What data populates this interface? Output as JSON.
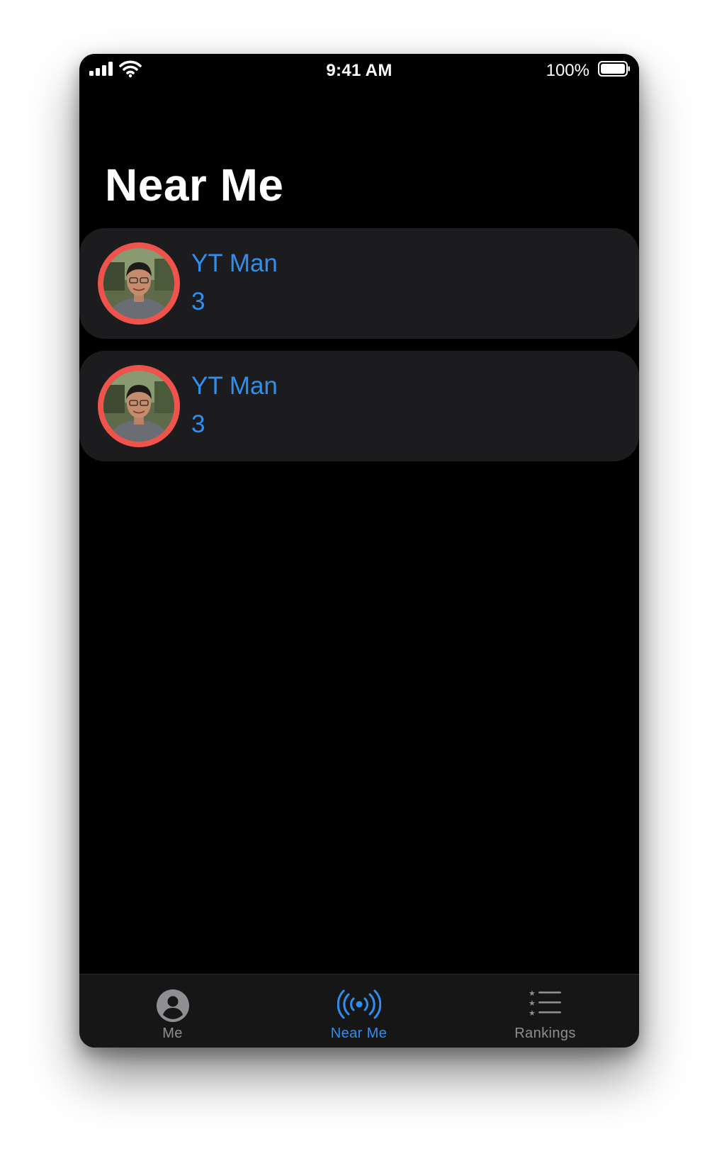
{
  "status_bar": {
    "time": "9:41 AM",
    "battery_percent": "100%",
    "icons": [
      "signal-icon",
      "wifi-icon",
      "battery-icon"
    ]
  },
  "page_title": "Near Me",
  "people": [
    {
      "name": "YT Man",
      "count": "3",
      "avatar": "profile-photo"
    },
    {
      "name": "YT Man",
      "count": "3",
      "avatar": "profile-photo"
    }
  ],
  "tab_bar": {
    "tabs": [
      {
        "label": "Me",
        "icon": "person-circle-icon",
        "selected": false
      },
      {
        "label": "Near Me",
        "icon": "broadcast-icon",
        "selected": true
      },
      {
        "label": "Rankings",
        "icon": "star-list-icon",
        "selected": false
      }
    ]
  },
  "colors": {
    "accent": "#2f8ff0",
    "avatar_ring": "#f0534b",
    "row_background": "#1c1c1e",
    "inactive_tab": "#8e8e93"
  }
}
